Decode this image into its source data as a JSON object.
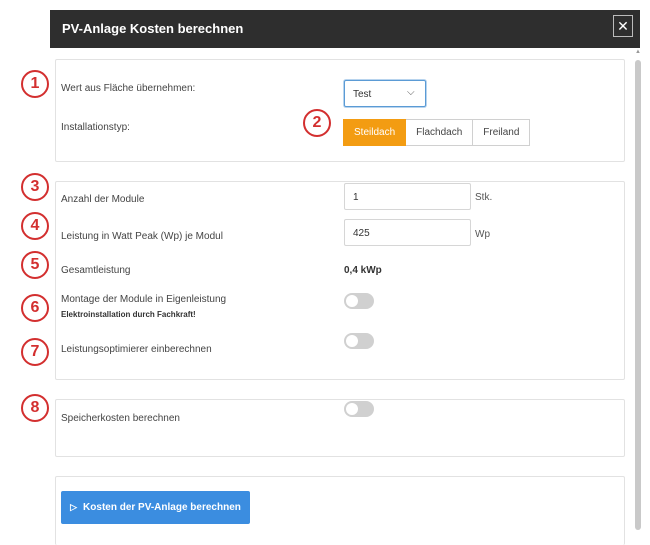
{
  "header": {
    "title": "PV-Anlage Kosten berechnen",
    "close_label": "✕"
  },
  "section1": {
    "area_label": "Wert aus Fläche übernehmen:",
    "area_select": {
      "value": "Test",
      "chevron": "⌵"
    },
    "install_label": "Installationstyp:",
    "install_options": [
      "Steildach",
      "Flachdach",
      "Freiland"
    ],
    "install_selected": "Steildach"
  },
  "section2": {
    "modules_label": "Anzahl der Module",
    "modules_value": "1",
    "modules_unit": "Stk.",
    "power_label": "Leistung in Watt Peak (Wp) je Modul",
    "power_value": "425",
    "power_unit": "Wp",
    "total_label": "Gesamtleistung",
    "total_value": "0,4 kWp",
    "self_install_label": "Montage der Module in Eigenleistung",
    "self_install_note": "Elektroinstallation durch Fachkraft!",
    "self_install_on": false,
    "optimizer_label": "Leistungsoptimierer einberechnen",
    "optimizer_on": false
  },
  "section3": {
    "storage_label": "Speicherkosten berechnen",
    "storage_on": false
  },
  "action": {
    "icon": "▷",
    "label": "Kosten der PV-Anlage berechnen"
  },
  "badges": [
    "1",
    "2",
    "3",
    "4",
    "5",
    "6",
    "7",
    "8"
  ],
  "colors": {
    "header_bg": "#2e2e2e",
    "accent_orange": "#f39c12",
    "button_blue": "#3b8de0",
    "badge_red": "#d32f2f",
    "toggle_off": "#d0d0d0"
  }
}
